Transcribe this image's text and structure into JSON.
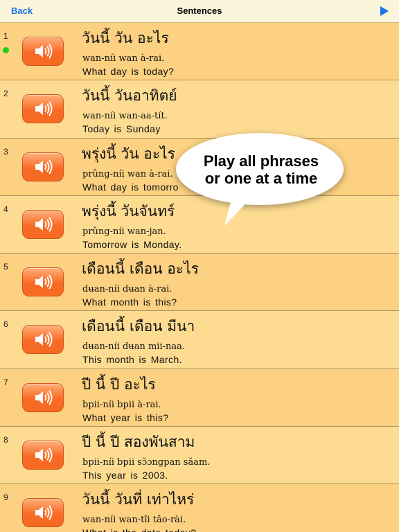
{
  "nav": {
    "back_label": "Back",
    "title": "Sentences",
    "play_icon": "play-icon",
    "accent": "#1a73e8"
  },
  "rows": [
    {
      "num": "1",
      "thai": "วันนี้ วัน อะไร",
      "translit": "wan-níi wan à-rai.",
      "english": "What day is today?",
      "active": true
    },
    {
      "num": "2",
      "thai": "วันนี้ วันอาทิตย์",
      "translit": "wan-níi wan-aa-tít.",
      "english": "Today is Sunday"
    },
    {
      "num": "3",
      "thai": "พรุ่งนี้ วัน อะไร",
      "translit": "prûng-níi wan à-rai.",
      "english": "What day is tomorro"
    },
    {
      "num": "4",
      "thai": "พรุ่งนี้ วันจันทร์",
      "translit": "prûng-níi wan-jan.",
      "english": "Tomorrow is Monday."
    },
    {
      "num": "5",
      "thai": "เดือนนี้ เดือน อะไร",
      "translit": "dʉan-níi dʉan à-rai.",
      "english": "What month is this?"
    },
    {
      "num": "6",
      "thai": "เดือนนี้ เดือน มีนา",
      "translit": "dʉan-níi dʉan mii-naa.",
      "english": "This month is March."
    },
    {
      "num": "7",
      "thai": "ปี นี้ ปี อะไร",
      "translit": "bpii-níi bpii à-rai.",
      "english": "What year is this?"
    },
    {
      "num": "8",
      "thai": "ปี นี้ ปี สองพันสาม",
      "translit": "bpii-níi bpii sɔ̌ɔngpan sǎam.",
      "english": "This year is 2003."
    },
    {
      "num": "9",
      "thai": "วันนี้ วันที่ เท่าไหร่",
      "translit": "wan-níi wan-tîi tâo-rài.",
      "english": "What is the date today?"
    }
  ],
  "bubble": {
    "line1": "Play all phrases",
    "line2": "or one at a time"
  },
  "colors": {
    "row_odd": "#fcd181",
    "row_even": "#fddc92",
    "button_orange": "#f86a25",
    "status_green": "#18d118"
  }
}
